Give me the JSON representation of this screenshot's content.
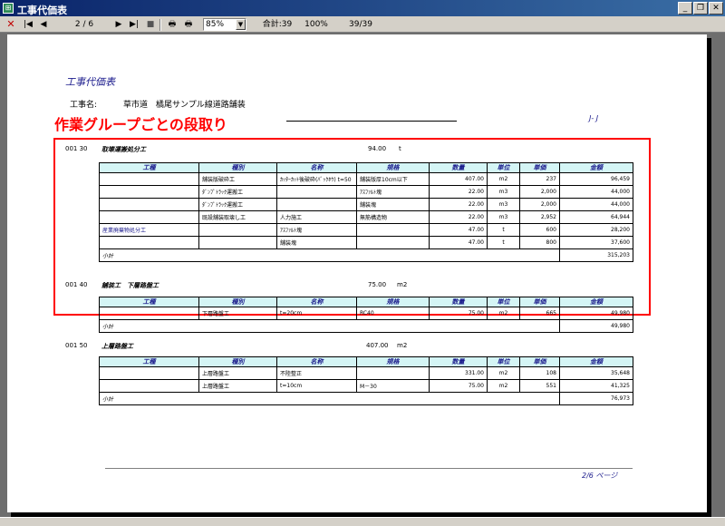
{
  "window": {
    "title": "工事代価表",
    "buttons": {
      "minimize": "_",
      "restore": "❐",
      "close": "✕"
    }
  },
  "toolbar": {
    "close_glyph": "✕",
    "first_glyph": "|◀",
    "prev_glyph": "◀",
    "page_indicator": "2 / 6",
    "next_glyph": "▶",
    "last_glyph": "▶|",
    "stop_glyph": "■",
    "print_glyph": "🖶",
    "setup_glyph": "🖶",
    "zoom_value": "85%",
    "total_label": "合計:39",
    "percent": "100%",
    "record_count": "39/39"
  },
  "report": {
    "title": "工事代価表",
    "project_label": "工事名:",
    "project_name": "草市道　橘尾サンプル線道路舗装",
    "annotation": "作業グループごとの段取り",
    "jj": "J- J",
    "footer_page": "2/6 ページ",
    "columns": [
      "工種",
      "種別",
      "名称",
      "規格",
      "数量",
      "単位",
      "単価",
      "金額"
    ],
    "sections": [
      {
        "code": "001 30",
        "name": "取壊運搬処分工",
        "qty": "94.00",
        "unit": "t",
        "rows": [
          {
            "c0": "",
            "c1": "舗装版破砕工",
            "c2": "ｶｯﾀｰｶｯﾄ後破砕(ﾊﾞｯｸﾎｳ) t=50",
            "c3": "舗装版厚10cm以下",
            "c4": "407.00",
            "c5": "m2",
            "c6": "237",
            "c7": "96,459"
          },
          {
            "c0": "",
            "c1": "ﾀﾞﾝﾌﾟﾄﾗｯｸ運搬工",
            "c2": "",
            "c3": "ｱｽﾌｧﾙﾄ塊",
            "c4": "22.00",
            "c5": "m3",
            "c6": "2,000",
            "c7": "44,000"
          },
          {
            "c0": "",
            "c1": "ﾀﾞﾝﾌﾟﾄﾗｯｸ運搬工",
            "c2": "",
            "c3": "舗装塊",
            "c4": "22.00",
            "c5": "m3",
            "c6": "2,000",
            "c7": "44,000"
          },
          {
            "c0": "",
            "c1": "既設舗装取壊し工",
            "c2": "人力施工",
            "c3": "無筋構造物",
            "c4": "22.00",
            "c5": "m3",
            "c6": "2,952",
            "c7": "64,944"
          },
          {
            "c0": "産業廃棄物処分工",
            "c1": "",
            "c2": "ｱｽﾌｧﾙﾄ塊",
            "c3": "",
            "c4": "47.00",
            "c5": "t",
            "c6": "600",
            "c7": "28,200"
          },
          {
            "c0": "",
            "c1": "",
            "c2": "舗装塊",
            "c3": "",
            "c4": "47.00",
            "c5": "t",
            "c6": "800",
            "c7": "37,600"
          }
        ],
        "subtotal_label": "小計",
        "subtotal": "315,203"
      },
      {
        "code": "001 40",
        "name": "舗装工　下層路盤工",
        "qty": "75.00",
        "unit": "m2",
        "rows": [
          {
            "c0": "",
            "c1": "下層路盤工",
            "c2": "t=20cm",
            "c3": "RC40",
            "c4": "75.00",
            "c5": "m2",
            "c6": "665",
            "c7": "49,980"
          }
        ],
        "subtotal_label": "小計",
        "subtotal": "49,980"
      },
      {
        "code": "001 50",
        "name": "上層路盤工",
        "qty": "407.00",
        "unit": "m2",
        "rows": [
          {
            "c0": "",
            "c1": "上層路盤工",
            "c2": "不陸整正",
            "c3": "",
            "c4": "331.00",
            "c5": "m2",
            "c6": "108",
            "c7": "35,648"
          },
          {
            "c0": "",
            "c1": "上層路盤工",
            "c2": "t=10cm",
            "c3": "M－30",
            "c4": "75.00",
            "c5": "m2",
            "c6": "551",
            "c7": "41,325"
          }
        ],
        "subtotal_label": "小計",
        "subtotal": "76,973"
      }
    ]
  }
}
